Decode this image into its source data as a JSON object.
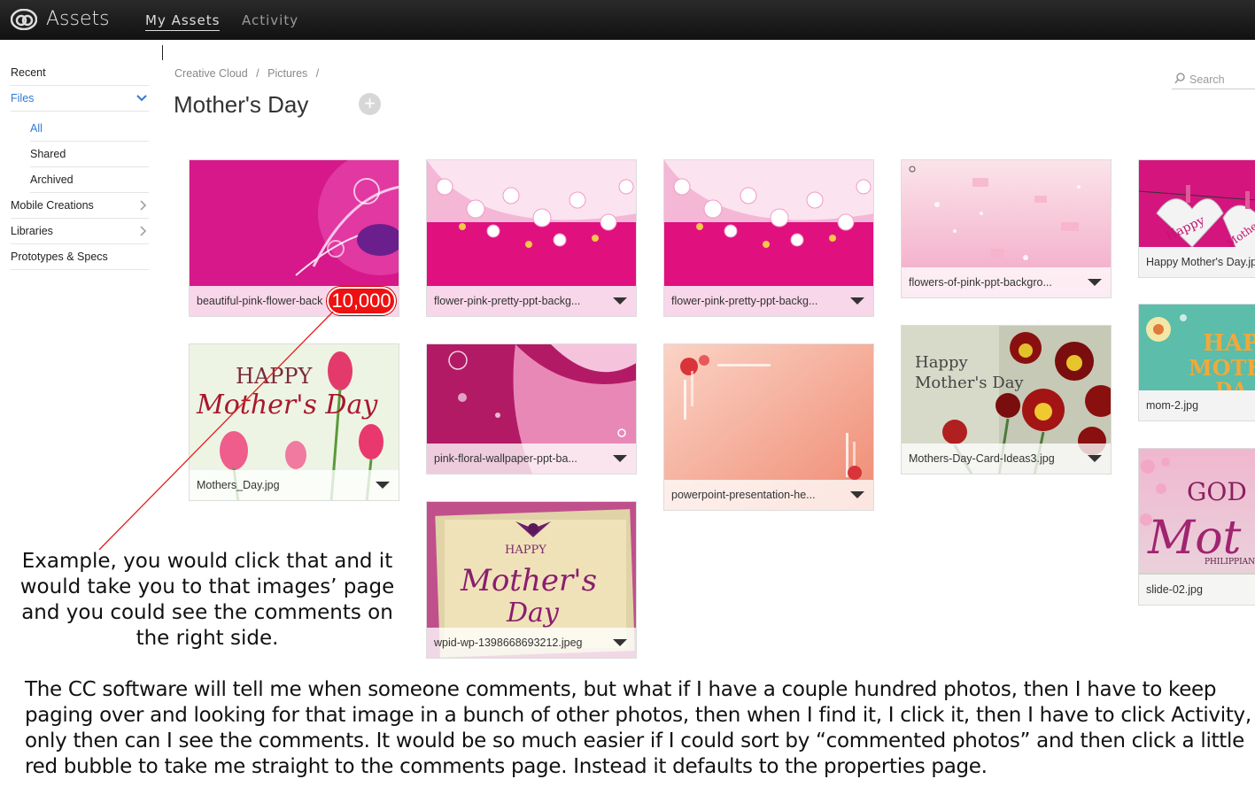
{
  "header": {
    "app_title": "Assets",
    "tabs": [
      {
        "label": "My Assets",
        "active": true
      },
      {
        "label": "Activity",
        "active": false
      }
    ]
  },
  "sidebar": {
    "items": [
      {
        "label": "Recent"
      },
      {
        "label": "Files"
      },
      {
        "label": "All"
      },
      {
        "label": "Shared"
      },
      {
        "label": "Archived"
      },
      {
        "label": "Mobile Creations"
      },
      {
        "label": "Libraries"
      },
      {
        "label": "Prototypes & Specs"
      }
    ]
  },
  "breadcrumb": [
    "Creative Cloud",
    "/",
    "Pictures",
    "/"
  ],
  "page_title": "Mother's Day",
  "add_icon": "+",
  "search": {
    "placeholder": "Search"
  },
  "files": [
    {
      "name": "beautiful-pink-flower-back"
    },
    {
      "name": "flower-pink-pretty-ppt-backg..."
    },
    {
      "name": "flower-pink-pretty-ppt-backg..."
    },
    {
      "name": "flowers-of-pink-ppt-backgro..."
    },
    {
      "name": "Happy Mother's Day.jp"
    },
    {
      "name": "Mothers_Day.jpg"
    },
    {
      "name": "pink-floral-wallpaper-ppt-ba..."
    },
    {
      "name": "powerpoint-presentation-he..."
    },
    {
      "name": "Mothers-Day-Card-Ideas3.jpg"
    },
    {
      "name": "mom-2.jpg"
    },
    {
      "name": "wpid-wp-1398668693212.jpeg"
    },
    {
      "name": "slide-02.jpg"
    }
  ],
  "thumb_text": {
    "happy_mothers_day": [
      "HAPPY",
      "Mother's Day"
    ],
    "card_happy": "Happy",
    "card_mothers_day": "Mother's Day",
    "hearts": [
      "Happy",
      "Mother"
    ],
    "mom2": [
      "HAP",
      "MOTH",
      "DA"
    ],
    "slide02": [
      "GOD",
      "Mot",
      "PHILIPPIAN"
    ],
    "wpid": [
      "HAPPY",
      "Mother's",
      "Day"
    ]
  },
  "comment_badge": "10,000",
  "annotations": {
    "note1": "Example, you would click that and it would take you to that images’ page and you could see the comments on the right side.",
    "note2": "The CC software will tell me when someone comments, but what if I have a couple hundred photos, then I have to keep paging over and looking for that image in a bunch of other photos, then when I find it, I click it, then I have to click Activity, only then can I see the comments. It would be so much easier if I could sort by “commented photos” and then click a little red bubble to take me straight to the comments page. Instead it defaults to the properties page."
  },
  "colors": {
    "accent": "#2d7ad6",
    "badge": "#ee1111",
    "topbar": "#1a1a1a"
  }
}
